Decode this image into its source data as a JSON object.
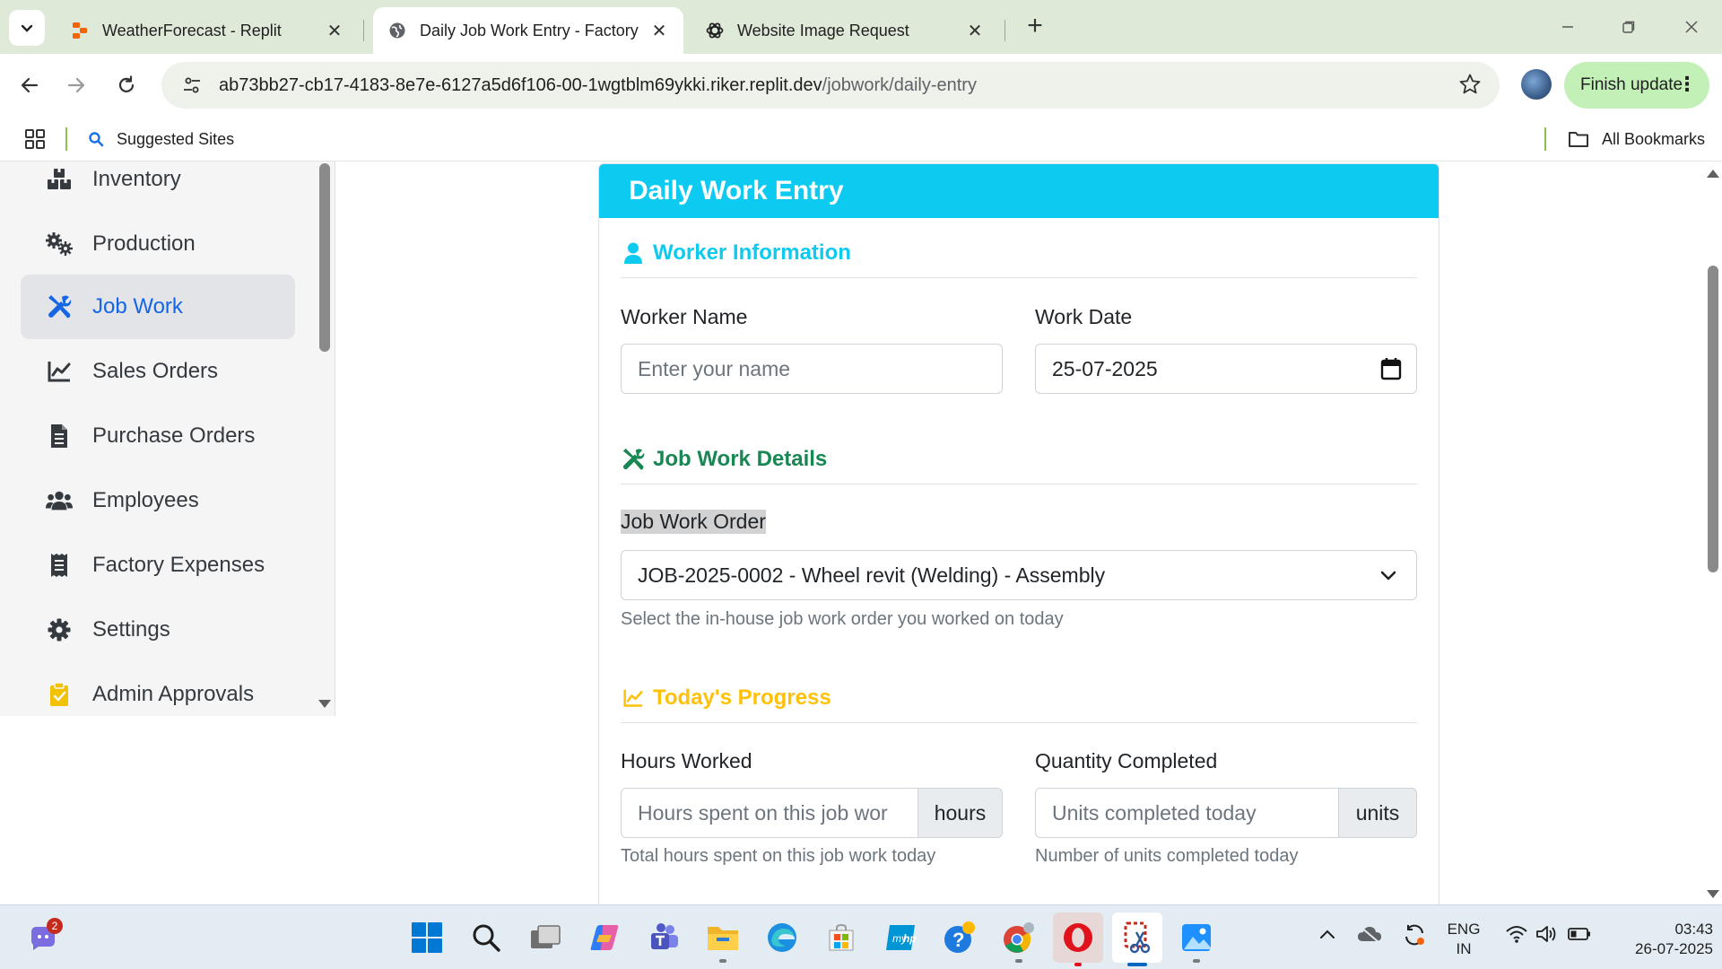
{
  "browser": {
    "tabs": [
      {
        "title": "WeatherForecast - Replit",
        "active": false
      },
      {
        "title": "Daily Job Work Entry - Factory M",
        "active": true
      },
      {
        "title": "Website Image Request",
        "active": false
      }
    ],
    "url_host": "ab73bb27-cb17-4183-8e7e-6127a5d6f106-00-1wgtblm69ykki.riker.replit.dev",
    "url_path": "/jobwork/daily-entry",
    "finish_update_label": "Finish update",
    "bookmarks": {
      "suggested": "Suggested Sites",
      "all": "All Bookmarks"
    }
  },
  "sidebar": {
    "items": [
      {
        "label": "Inventory",
        "icon": "boxes-icon",
        "active": false
      },
      {
        "label": "Production",
        "icon": "gears-icon",
        "active": false
      },
      {
        "label": "Job Work",
        "icon": "tools-icon",
        "active": true
      },
      {
        "label": "Sales Orders",
        "icon": "chart-line-icon",
        "active": false
      },
      {
        "label": "Purchase Orders",
        "icon": "file-invoice-icon",
        "active": false
      },
      {
        "label": "Employees",
        "icon": "users-icon",
        "active": false
      },
      {
        "label": "Factory Expenses",
        "icon": "receipt-icon",
        "active": false
      },
      {
        "label": "Settings",
        "icon": "cog-icon",
        "active": false
      },
      {
        "label": "Admin Approvals",
        "icon": "clipboard-check-icon",
        "active": false
      }
    ]
  },
  "form": {
    "title": "Daily Work Entry",
    "sections": {
      "worker": {
        "title": "Worker Information",
        "color": "#0dcaf0"
      },
      "job": {
        "title": "Job Work Details",
        "color": "#198754"
      },
      "progress": {
        "title": "Today's Progress",
        "color": "#ffc107"
      }
    },
    "worker_name": {
      "label": "Worker Name",
      "placeholder": "Enter your name",
      "value": ""
    },
    "work_date": {
      "label": "Work Date",
      "value": "25-07-2025"
    },
    "job_work_order": {
      "label": "Job Work Order",
      "selected": "JOB-2025-0002 - Wheel revit (Welding) - Assembly",
      "help": "Select the in-house job work order you worked on today"
    },
    "hours_worked": {
      "label": "Hours Worked",
      "placeholder": "Hours spent on this job wor",
      "addon": "hours",
      "help": "Total hours spent on this job work today"
    },
    "quantity_completed": {
      "label": "Quantity Completed",
      "placeholder": "Units completed today",
      "addon": "units",
      "help": "Number of units completed today"
    }
  },
  "taskbar": {
    "badge_count": "2",
    "lang_line1": "ENG",
    "lang_line2": "IN",
    "time": "03:43",
    "date": "26-07-2025"
  },
  "colors": {
    "header": "#0dcaf0",
    "active_nav": "#1565e4",
    "chrome": "#dfe9d8"
  }
}
